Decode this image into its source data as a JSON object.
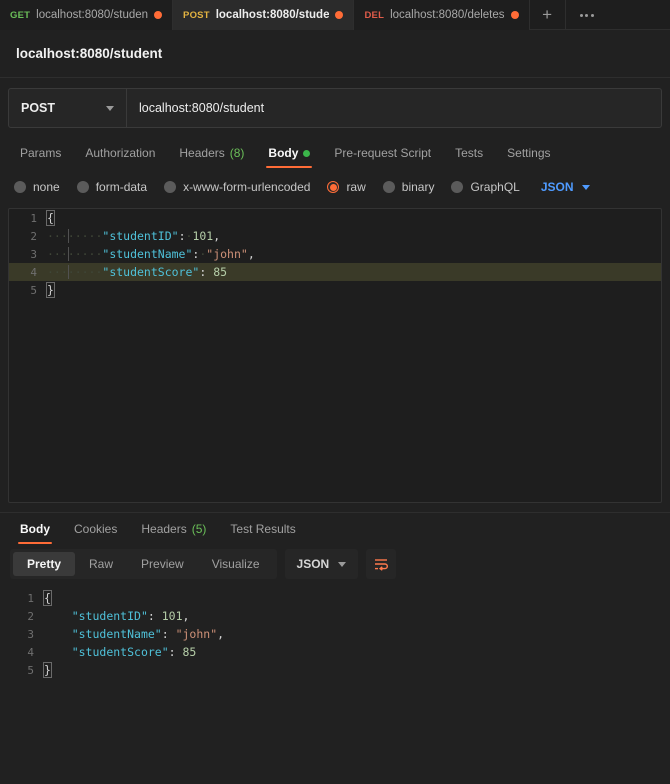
{
  "tabs": [
    {
      "method": "GET",
      "name": "localhost:8080/studen",
      "unsaved": true,
      "active": false
    },
    {
      "method": "POST",
      "name": "localhost:8080/stude",
      "unsaved": true,
      "active": true
    },
    {
      "method": "DEL",
      "name": "localhost:8080/deletes",
      "unsaved": true,
      "active": false
    }
  ],
  "tabbar": {
    "new_tab_label": "+"
  },
  "header": {
    "title": "localhost:8080/student"
  },
  "request": {
    "method": "POST",
    "url": "localhost:8080/student",
    "tabs": [
      {
        "label": "Params",
        "active": false
      },
      {
        "label": "Authorization",
        "active": false
      },
      {
        "label": "Headers",
        "count": "(8)",
        "active": false
      },
      {
        "label": "Body",
        "dot": true,
        "active": true
      },
      {
        "label": "Pre-request Script",
        "active": false
      },
      {
        "label": "Tests",
        "active": false
      },
      {
        "label": "Settings",
        "active": false
      }
    ],
    "body_types": [
      {
        "label": "none",
        "selected": false
      },
      {
        "label": "form-data",
        "selected": false
      },
      {
        "label": "x-www-form-urlencoded",
        "selected": false
      },
      {
        "label": "raw",
        "selected": true
      },
      {
        "label": "binary",
        "selected": false
      },
      {
        "label": "GraphQL",
        "selected": false
      }
    ],
    "format": "JSON",
    "code_lines": [
      {
        "no": "1",
        "tokens": [
          {
            "t": "{",
            "c": "brace"
          }
        ],
        "highlight": false
      },
      {
        "no": "2",
        "tokens": [
          {
            "t": "········",
            "c": "ws"
          },
          {
            "t": "\"studentID\"",
            "c": "k"
          },
          {
            "t": ":",
            "c": "p"
          },
          {
            "t": "·",
            "c": "ws"
          },
          {
            "t": "101",
            "c": "n"
          },
          {
            "t": ",",
            "c": "p"
          }
        ],
        "highlight": false
      },
      {
        "no": "3",
        "tokens": [
          {
            "t": "········",
            "c": "ws"
          },
          {
            "t": "\"studentName\"",
            "c": "k"
          },
          {
            "t": ":",
            "c": "p"
          },
          {
            "t": "·",
            "c": "ws"
          },
          {
            "t": "\"john\"",
            "c": "s"
          },
          {
            "t": ",",
            "c": "p"
          }
        ],
        "highlight": false
      },
      {
        "no": "4",
        "tokens": [
          {
            "t": "········",
            "c": "ws"
          },
          {
            "t": "\"studentScore\"",
            "c": "k"
          },
          {
            "t": ":",
            "c": "p"
          },
          {
            "t": " ",
            "c": "p"
          },
          {
            "t": "85",
            "c": "n"
          }
        ],
        "highlight": true
      },
      {
        "no": "5",
        "tokens": [
          {
            "t": "}",
            "c": "brace"
          }
        ],
        "highlight": false
      }
    ]
  },
  "response": {
    "tabs": [
      {
        "label": "Body",
        "active": true
      },
      {
        "label": "Cookies",
        "active": false
      },
      {
        "label": "Headers",
        "count": "(5)",
        "active": false
      },
      {
        "label": "Test Results",
        "active": false
      }
    ],
    "views": [
      {
        "label": "Pretty",
        "active": true
      },
      {
        "label": "Raw",
        "active": false
      },
      {
        "label": "Preview",
        "active": false
      },
      {
        "label": "Visualize",
        "active": false
      }
    ],
    "format": "JSON",
    "code_lines": [
      {
        "no": "1",
        "tokens": [
          {
            "t": "{",
            "c": "brace"
          }
        ]
      },
      {
        "no": "2",
        "tokens": [
          {
            "t": "    ",
            "c": "p"
          },
          {
            "t": "\"studentID\"",
            "c": "k"
          },
          {
            "t": ": ",
            "c": "p"
          },
          {
            "t": "101",
            "c": "n"
          },
          {
            "t": ",",
            "c": "p"
          }
        ]
      },
      {
        "no": "3",
        "tokens": [
          {
            "t": "    ",
            "c": "p"
          },
          {
            "t": "\"studentName\"",
            "c": "k"
          },
          {
            "t": ": ",
            "c": "p"
          },
          {
            "t": "\"john\"",
            "c": "s"
          },
          {
            "t": ",",
            "c": "p"
          }
        ]
      },
      {
        "no": "4",
        "tokens": [
          {
            "t": "    ",
            "c": "p"
          },
          {
            "t": "\"studentScore\"",
            "c": "k"
          },
          {
            "t": ": ",
            "c": "p"
          },
          {
            "t": "85",
            "c": "n"
          }
        ]
      },
      {
        "no": "5",
        "tokens": [
          {
            "t": "}",
            "c": "brace"
          }
        ]
      }
    ]
  },
  "colors": {
    "accent": "#ff6c37",
    "background": "#212121",
    "editor_background": "#1e1e1e",
    "method_get": "#6bbf59",
    "method_post": "#e3b341",
    "method_del": "#e05c4a",
    "json_link": "#4f9bff",
    "green_badge": "#6bbf59",
    "key": "#4fc1d9",
    "string": "#ce9178",
    "number": "#b5cea8",
    "highlight_line": "#3a3a28"
  }
}
